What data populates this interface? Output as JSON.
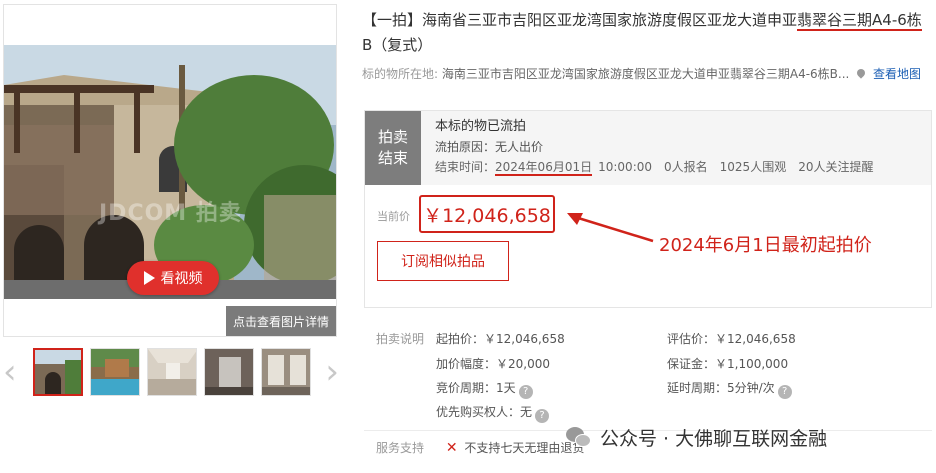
{
  "gallery": {
    "watermark": "JDCOM  拍卖",
    "video_label": "看视频",
    "detail_label": "点击查看图片详情",
    "thumb_count": 5,
    "active_thumb": 0
  },
  "listing": {
    "title_prefix": "【一拍】海南省三亚市吉阳区亚龙湾国家旅游度假区亚龙大道申亚",
    "title_underlined": "翡翠谷三期A4-6栋",
    "title_suffix": "B（复式）",
    "location_label": "标的物所在地:",
    "location_value": "海南三亚市吉阳区亚龙湾国家旅游度假区亚龙大道申亚翡翠谷三期A4-6栋B...",
    "map_link": "查看地图"
  },
  "status": {
    "tag_line1": "拍卖",
    "tag_line2": "结束",
    "main": "本标的物已流拍",
    "reason": "流拍原因：无人出价",
    "end_label": "结束时间：",
    "end_date": "2024年06月01日",
    "end_time": "10:00:00",
    "signups": "0人报名",
    "viewers": "1025人围观",
    "followers": "20人关注提醒"
  },
  "price": {
    "label": "当前价",
    "value": "￥12,046,658",
    "subscribe": "订阅相似拍品"
  },
  "annotation": {
    "text": "2024年6月1日最初起拍价"
  },
  "rules": {
    "label": "拍卖说明",
    "start_price": "起拍价：￥12,046,658",
    "increment": "加价幅度：￥20,000",
    "bid_period": "竞价周期：1天",
    "priority": "优先购买权人：无",
    "appraisal": "评估价：￥12,046,658",
    "deposit": "保证金：￥1,100,000",
    "extension": "延时周期：5分钟/次"
  },
  "service": {
    "label": "服务支持",
    "item": "不支持七天无理由退货"
  },
  "wechat": {
    "text": "公众号 · 大佛聊互联网金融"
  },
  "colors": {
    "accent": "#d0231a",
    "link": "#1d5fb4"
  }
}
